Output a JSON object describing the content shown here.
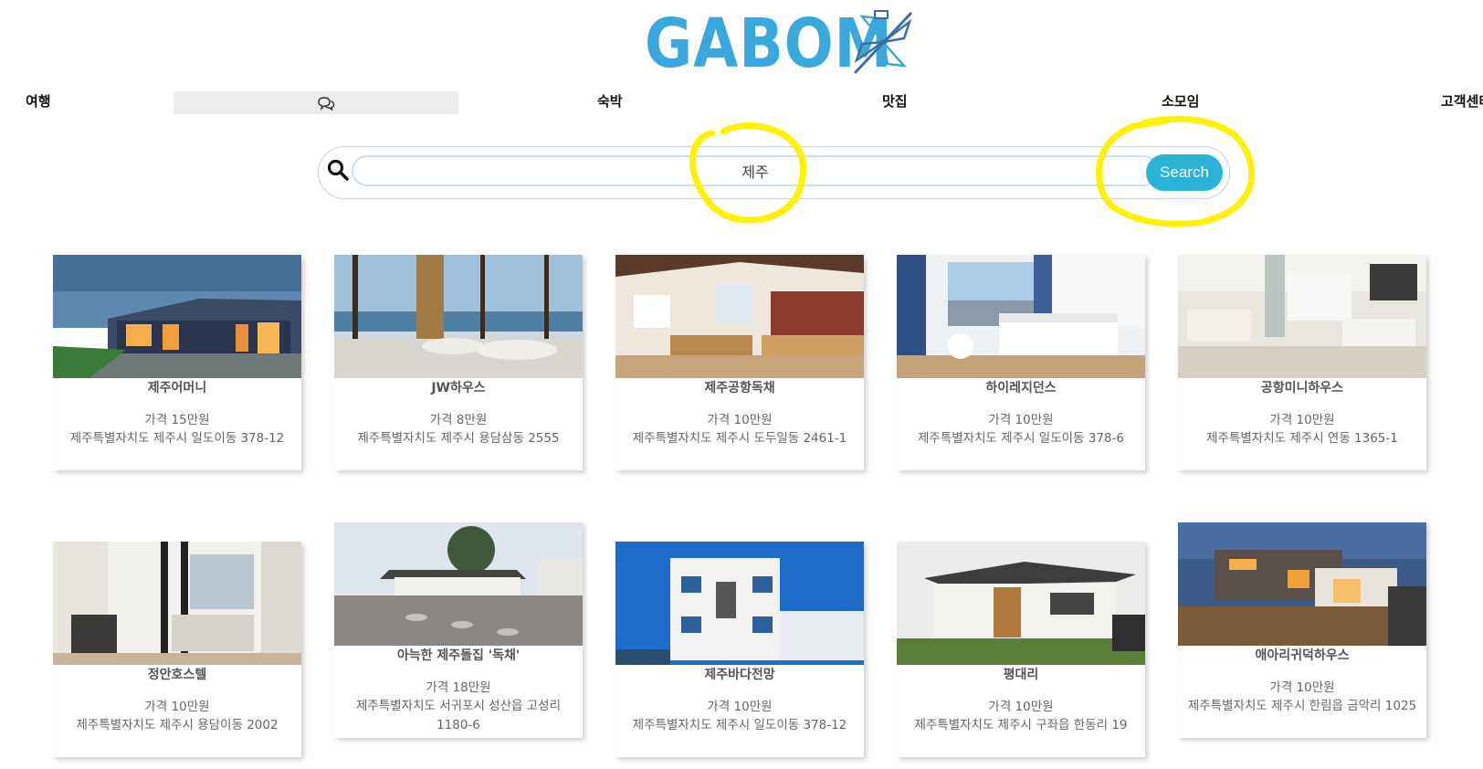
{
  "logo": {
    "text": "GABOM"
  },
  "nav": {
    "travel": "여행",
    "lodging": "숙박",
    "food": "맛집",
    "meetup": "소모임",
    "support": "고객센터",
    "chat_icon": "chat-bubbles-icon"
  },
  "search": {
    "value": "제주",
    "button_label": "Search",
    "icon": "search-icon",
    "annotation_color": "#fff200"
  },
  "colors": {
    "brand": "#3aa8dc",
    "button": "#2ab3d6"
  },
  "cards": [
    {
      "name": "제주어머니",
      "price": "가격 15만원",
      "address": "제주특별자치도 제주시 일도이동 378-12"
    },
    {
      "name": "JW하우스",
      "price": "가격 8만원",
      "address": "제주특별자치도 제주시 용담삼동 2555"
    },
    {
      "name": "제주공항독채",
      "price": "가격 10만원",
      "address": "제주특별자치도 제주시 도두일동 2461-1"
    },
    {
      "name": "하이레지던스",
      "price": "가격 10만원",
      "address": "제주특별자치도 제주시 일도이동 378-6"
    },
    {
      "name": "공항미니하우스",
      "price": "가격 10만원",
      "address": "제주특별자치도 제주시 연동 1365-1"
    },
    {
      "name": "정안호스텔",
      "price": "가격 10만원",
      "address": "제주특별자치도 제주시 용담이동 2002"
    },
    {
      "name": "아늑한 제주돌집 '독채'",
      "price": "가격 18만원",
      "address": "제주특별자치도 서귀포시 성산읍 고성리 1180-6"
    },
    {
      "name": "제주바다전망",
      "price": "가격 10만원",
      "address": "제주특별자치도 제주시 일도이동 378-12"
    },
    {
      "name": "평대리",
      "price": "가격 10만원",
      "address": "제주특별자치도 제주시 구좌읍 한동리 19"
    },
    {
      "name": "애아리귀덕하우스",
      "price": "가격 10만원",
      "address": "제주특별자치도 제주시 한림읍 금악리 1025"
    }
  ]
}
